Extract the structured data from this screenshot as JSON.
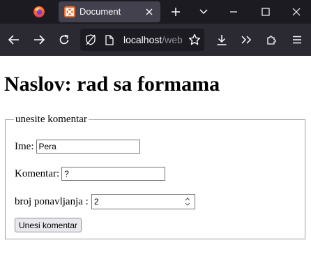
{
  "browser": {
    "tab": {
      "title": "Document"
    },
    "address_bar": {
      "host": "localhost",
      "path": "/web"
    }
  },
  "page": {
    "heading": "Naslov: rad sa formama",
    "fieldset": {
      "legend": "unesite komentar",
      "name": {
        "label": "Ime:",
        "value": "Pera"
      },
      "comment": {
        "label": "Komentar:",
        "value": "?"
      },
      "repeat": {
        "label": "broj ponavljanja :",
        "value": "2"
      },
      "submit_label": "Unesi komentar"
    }
  },
  "colors": {
    "tab_bar_bg": "#1c1b22",
    "toolbar_bg": "#2b2a33",
    "active_tab_bg": "#42414d",
    "favicon": "#e66f2e"
  },
  "icons": [
    "firefox-icon",
    "xampp-favicon-icon",
    "close-icon",
    "new-tab-icon",
    "chevron-down-icon",
    "minimize-icon",
    "maximize-icon",
    "window-close-icon",
    "back-icon",
    "forward-icon",
    "reload-icon",
    "tracking-protection-icon",
    "page-icon",
    "bookmark-star-icon",
    "downloads-icon",
    "overflow-chevrons-icon",
    "extensions-icon",
    "menu-icon"
  ]
}
